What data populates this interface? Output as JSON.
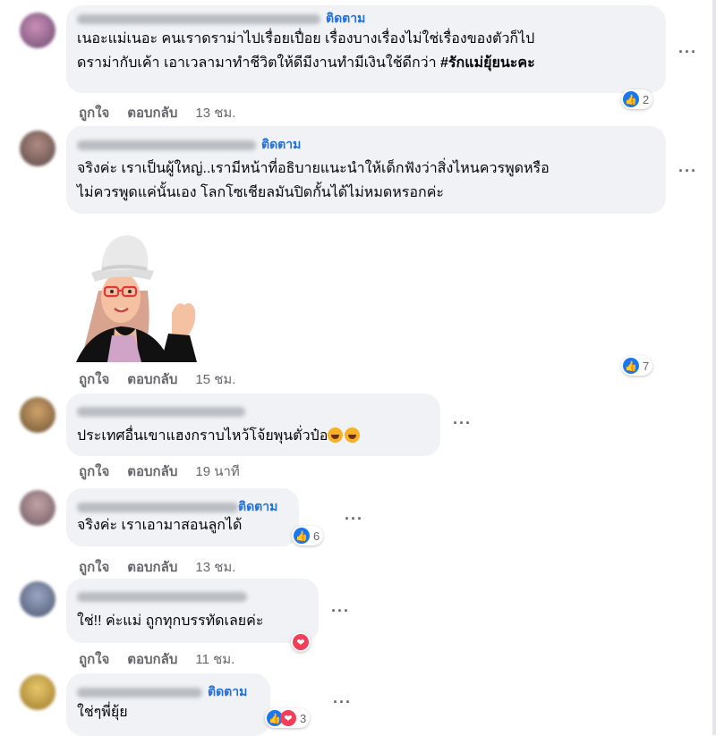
{
  "follow_label": "ติดตาม",
  "like_label": "ถูกใจ",
  "reply_label": "ตอบกลับ",
  "more_label": "···",
  "comments": [
    {
      "text_line1": "เนอะแม่เนอะ คนเราดราม่าไปเรื่อยเปื่อย เรื่องบางเรื่องไม่ใช่เรื่องของตัวก็ไป",
      "text_line2": "ดราม่ากับเค้า เอาเวลามาทำชีวิตให้ดีมีงานทำมีเงินใช้ดีกว่า",
      "hashtag": "#รักแม่ยุ้ยนะคะ",
      "reaction_count": "2",
      "time": "13 ชม."
    },
    {
      "text_line1": "จริงค่ะ เราเป็นผู้ใหญ่..เรามีหน้าที่อธิบายแนะนำให้เด็กฟังว่าสิ่งไหนควรพูดหรือ",
      "text_line2": "ไม่ควรพูดแค่นั้นเอง โลกโซเชียลมันปิดกั้นได้ไม่หมดหรอกค่ะ",
      "reaction_count": "",
      "time": ""
    },
    {
      "sticker": "woman-in-hat-sticker",
      "reaction_count": "7",
      "time": "15 ชม."
    },
    {
      "text": "ประเทศอื่นเขาแฮงกราบไหว้โจ้ยพุนตั่วป๋อ",
      "time": "19 นาที"
    },
    {
      "text": "จริงค่ะ เราเอามาสอนลูกได้",
      "reaction_count": "6",
      "time": "13 ชม."
    },
    {
      "text": "ใช่!! ค่ะแม่ ถูกทุกบรรทัดเลยค่ะ",
      "time": "11 ชม."
    },
    {
      "text": "ใช่ๆพี่ยุ้ย",
      "reaction_count": "3"
    }
  ],
  "colors": {
    "accent": "#216fdb",
    "like": "#1877f2",
    "love": "#f33e58",
    "bubble": "#f0f2f5"
  }
}
